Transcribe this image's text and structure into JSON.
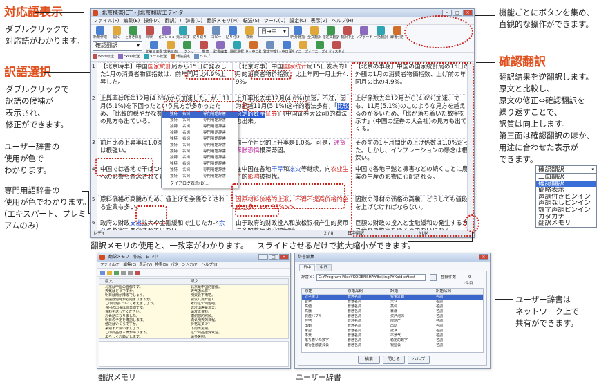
{
  "callouts": {
    "taiou": {
      "title": "対応語表示",
      "desc": "ダブルクリックで\n対応語がわかります。"
    },
    "yakugo": {
      "title": "訳語選択",
      "desc": "ダブルクリックで\n訳語の候補が\n表示され、\n修正ができます。"
    },
    "userdict": {
      "desc": "ユーザー辞書の\n使用が色で\nわかります。"
    },
    "senmon": {
      "desc": "専門用語辞書の\n使用が色でわかります。\n(エキスパート、プレミ\nアムのみ)"
    },
    "button": {
      "desc": "機能ごとにボタンを集め、\n直観的な操作ができます。"
    },
    "kakunin": {
      "title": "確認翻訳",
      "desc": "翻訳結果を逆翻訳します。\n原文と比較し、\n原文の修正⇔確認翻訳を\n繰り返すことで、\n訳質は向上します。\n第三面は確認翻訳のほか、\n用途に合わせた表示が\nできます。"
    },
    "memory_cap": "翻訳メモリの使用と、一致率がわかります。",
    "slide_cap": "スライドさせるだけで拡大縮小ができます。",
    "network": {
      "desc": "ユーザー辞書は\nネットワーク上で\n共有ができます。"
    }
  },
  "bottom_labels": {
    "memory": "翻訳メモリ",
    "userdict": "ユーザー辞書"
  },
  "mode_list": {
    "selected": "確認翻訳",
    "options": [
      "二面翻訳",
      "確認翻訳",
      "簡略表示",
      "声調付きピンイン",
      "声調なしピンイン",
      "数字声調ピンイン",
      "カタカナ",
      "翻訳メモリ"
    ],
    "active_index": 1
  },
  "window": {
    "title": "北京携帯JCT - J北京翻訳エディタ",
    "menu": [
      "ファイル(F)",
      "編集(E)",
      "操作(A)",
      "翻訳(T)",
      "辞書(D)",
      "翻訳メモリ(M)",
      "転送(S)",
      "ツール(U)",
      "設定(C)",
      "表示(V)",
      "ヘルプ(H)"
    ],
    "toolbar1": [
      "新規作成",
      "開く",
      "上書き保存",
      "印刷",
      "印刷プレビュー",
      "元に戻す",
      "切り取り",
      "コピー",
      "貼り付け",
      "検索"
    ],
    "direction": "日→中",
    "toolbar1b": [
      "専門分野指定",
      "全文翻訳",
      "指定文翻訳",
      "翻訳中止",
      "クリップボード翻訳",
      "一括翻訳",
      "辞書引き"
    ],
    "mode_select": "確認翻訳",
    "toolbar2": [
      "全文第三面翻訳",
      "指定文第三面翻訳",
      "ワークシップ",
      "一覧表",
      "辞書編集",
      "翻訳選択",
      "日中・中日辞典",
      "簡繁文字変換",
      "日中・中日漢字変換",
      "チャイニーズボード",
      "ジャパニーズボード",
      "ボイス中止"
    ],
    "toolbar3": [
      "Word転送",
      "Excel転送",
      "メール転送",
      "環境設定",
      "ヘルプ"
    ],
    "status_left": "レディ",
    "status_mid": "2 / 8",
    "status_mode": "日中翻訳",
    "status_num": "NUM",
    "row_numbers": [
      "1",
      "2",
      "3",
      "4",
      "5",
      "6"
    ]
  },
  "source": [
    {
      "pre": "【北京時事】中国",
      "red": "国家統計",
      "post": "局から15日に発表した1月の消費者物価指数は、前年同月比4.9%上昇した。"
    },
    {
      "pre": "上昇率は昨年",
      "mid": "12月(4.6%)から加速した。",
      "post": "が、11月(5.1%)を下回ったという見方が多かったため、「比較的穏やかな数字だ」(中国証券大手)との見方も出ている。"
    },
    {
      "pre": "前月比の上昇率は1.0%。しかし、インフ",
      "pink": "レ懸念",
      "post": "は根強い。"
    },
    {
      "pre": "中国では各地で干ばつや冷害が続き、",
      "pink": "農業生産",
      "post": "への影響も懸念されている。"
    },
    {
      "pre": "原料価格の高騰のため、値上げを余儀なくされる企業も多い。",
      "post": ""
    },
    {
      "pre": "政府の財政",
      "blue": "支出",
      "mid2": "拡大や金融緩和で生じたカネ",
      "blue2": "余り",
      "post": "の弊害も懸念されていない。"
    }
  ],
  "chinese": [
    {
      "pre": "【北京时事】中国",
      "red": "国家统计",
      "post": "局15日发表的1月的消费者物价指数，比上年同一月上升4.9%。"
    },
    {
      "pre": "上升率比去年12月(4.6%)加速，不过，因为超越11月(5.1%)这样的看法多有，「",
      "hi": "比较稳定的数字",
      "post": "」(中国证券大公司)",
      "red": "证券",
      "post2": "的看法也出来。"
    },
    {
      "pre": "前一个月比的上升率是1.0%。可是，",
      "pink": "通货膨胀恐惧",
      "post": "根深蒂固。"
    },
    {
      "pre": "在中国在各地",
      "blue": "干旱",
      "mid": "和",
      "blue2": "冻灾",
      "mid2": "等继续，向",
      "red": "农业生产",
      "post": "的",
      "red2": "影响",
      "post2": "被担忧。"
    },
    {
      "pre": "因原材料价格的上涨，不得不提高价格的企业也多。",
      "tag": "<< 85%>>"
    },
    {
      "pre": "由于政府的财政投入和放松银根产生的货币过多的弊病也没被解除。"
    }
  ],
  "back": [
    "【北京の事務】中国の国家統計局の15日の外観の1月の消費者物価指数、上げ前の年同月の比の4.9%。",
    "上げ係数去年12月から(4.6%)加速、でも、11月(5.1%)のこのような見方を越えるのが多いため、「比が落ち着いた数字を示す」(中国の証券の大会社)の見方も出てくる。",
    "その前の1ヶ月間比の上げ係数は1.0%だった。しかし、インフレーションの懸念は根深い。",
    "中国で各地早魃と凍害などの続くことに農業の生産の影響に心配される。",
    "因数の母材の価格の高騰、どうしても値段を上げなければならない。",
    "巨額の財政の投入と金融緩和の発生するカネ余りの弊害もゆるめでないになる。"
  ],
  "dropdown": {
    "rows": [
      [
        "独特",
        "名詞",
        "専門用語辞書"
      ],
      [
        "独特",
        "名詞",
        "専門用語辞書"
      ],
      [
        "独特",
        "名詞",
        "専門用語辞書"
      ],
      [
        "独特",
        "名詞",
        "専門用語辞書"
      ],
      [
        "独特",
        "名詞",
        "専門用語辞書"
      ],
      [
        "独特",
        "名詞",
        "専門用語辞書"
      ],
      [
        "独特",
        "名詞",
        "専門用語辞書"
      ],
      [
        "独特",
        "名詞",
        "専門用語辞書"
      ],
      [
        "独特",
        "名詞",
        "専門用語辞書"
      ],
      [
        "独特",
        "名詞",
        "専門用語辞書"
      ],
      [
        "独特",
        "名詞",
        "専門用語辞書"
      ]
    ],
    "footer": "ダイアログ表示(D)..."
  },
  "memory_window": {
    "title": "翻訳メモリ - 作成 - 日→中",
    "menu": [
      "ファイル(F)",
      "編集(E)",
      "表示(V)",
      "検索(S)",
      "パターン入力(P)",
      "ヘルプ(H)"
    ],
    "col_src": "原文",
    "col_tgt": "訳文",
    "rows": [
      [
        "北京は中国の首都です。",
        "北京是中国的首都。"
      ],
      [
        "天気はどうですか。",
        "天气怎么样?"
      ],
      [
        "明日は雨が降るでしょう。",
        "明天会下雨吧。"
      ],
      [
        "会議は何時から始まりますか。",
        "会议几点开始?"
      ],
      [
        "この問題について考えましょう。",
        "考虑这个问题吧。"
      ],
      [
        "今回の出張は三日間です。",
        "这次出差是三天。"
      ],
      [
        "資料を送ってください。",
        "请发送资料。"
      ],
      [
        "お世話になりました。",
        "谢谢您的照顾。"
      ],
      [
        "明日の予定を確認します。",
        "确认明天的日程。"
      ],
      [
        "値段はいくらですか。",
        "价格是多少?"
      ],
      [
        "来週また会いましょう。",
        "下周再见吧。"
      ],
      [
        "この商品は人気があります。",
        "这个商品很受欢迎。"
      ],
      [
        "よろしくお願いします。",
        "请多关照。"
      ]
    ]
  },
  "user_window": {
    "title": "辞書編集",
    "tabs": [
      "日中",
      "中日"
    ],
    "dict_label": "辞書名：",
    "dict_path": "C:¥Program Files¥KODENSHA¥Beijing7¥Koidic¥test",
    "count_label": "登録件数",
    "count": "9",
    "page": "1件目",
    "cols": [
      "原語",
      "原語品詞",
      "訳語",
      "訳語品詞"
    ],
    "rows": [
      [
        "カネ余り",
        "普通名詞",
        "资金过剩",
        "名詞"
      ],
      [
        "合衆",
        "普通名詞",
        "大众",
        "名詞"
      ],
      [
        "高値",
        "普通名詞",
        "高价",
        "名詞"
      ],
      [
        "高騰",
        "普通名詞",
        "暴涨",
        "名詞"
      ],
      [
        "資産バブル",
        "普通名詞",
        "资产泡沫",
        "名詞"
      ],
      [
        "住宅",
        "普通名詞",
        "房地产",
        "名詞"
      ],
      [
        "出動",
        "普通名詞",
        "出动",
        "名詞"
      ],
      [
        "承認",
        "普通名詞",
        "批准",
        "名詞"
      ],
      [
        "不景",
        "普通名詞",
        "不景气",
        "名詞"
      ],
      [
        "落ち着いた数字",
        "普通名詞",
        "稳定的数字",
        "名詞"
      ],
      [
        "銀行金融委員会",
        "普通名詞",
        "银监会",
        "名詞"
      ]
    ],
    "buttons": [
      "検索",
      "閉じる",
      "ヘルプ"
    ]
  },
  "colors": {
    "accent": "#e0501e",
    "dotted": "#d0241e",
    "blue": "#1d4fd0",
    "select": "#2a5ad4"
  }
}
